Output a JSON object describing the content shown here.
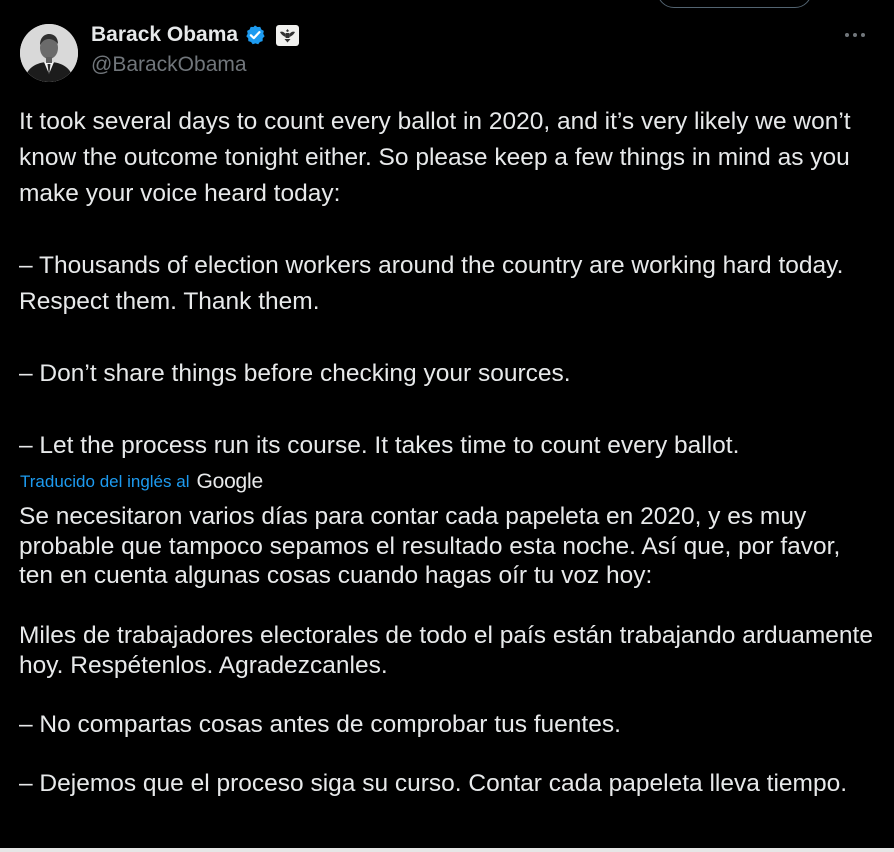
{
  "author": {
    "display_name": "Barack Obama",
    "handle": "@BarackObama",
    "verified": true,
    "verified_color": "#1d9bf0"
  },
  "icons": {
    "avatar": "profile-photo",
    "verified": "verified-badge-icon",
    "affiliation": "us-seal-icon",
    "more": "more-horizontal-icon"
  },
  "tweet": {
    "text": "It took several days to count every ballot in 2020, and it’s very likely we won’t know the outcome tonight either. So please keep a few things in mind as you make your voice heard today:\n\n– Thousands of election workers around the country are working hard today. Respect them. Thank them.\n\n– Don’t share things before checking your sources.\n\n– Let the process run its course. It takes time to count every ballot."
  },
  "translation": {
    "label": "Traducido del inglés al",
    "provider": "Google",
    "label_color": "#1d9bf0",
    "text": "Se necesitaron varios días para contar cada papeleta en 2020, y es muy probable que tampoco sepamos el resultado esta noche. Así que, por favor, ten en cuenta algunas cosas cuando hagas oír tu voz hoy:\n\nMiles de trabajadores electorales de todo el país están trabajando arduamente hoy. Respétenlos. Agradezcanles.\n\n– No compartas cosas antes de comprobar tus fuentes.\n\n– Dejemos que el proceso siga su curso. Contar cada papeleta lleva tiempo."
  },
  "theme": {
    "background": "#000000",
    "text": "#e7e9ea",
    "secondary_text": "#71767b"
  }
}
